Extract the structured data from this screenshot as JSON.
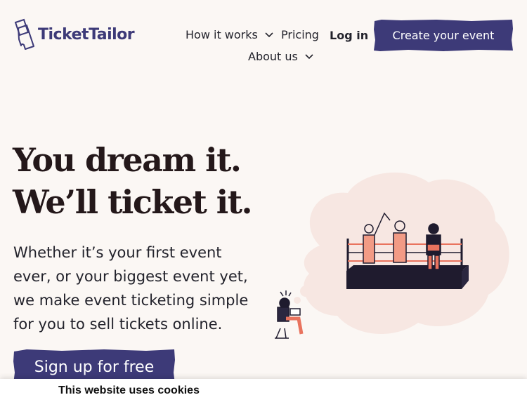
{
  "brand": {
    "name": "TicketTailor",
    "primary_color": "#3d3a78"
  },
  "nav": {
    "how_it_works": "How it works",
    "pricing": "Pricing",
    "login": "Log in",
    "about_us": "About us",
    "create_event": "Create your event"
  },
  "hero": {
    "title_line1": "You dream it.",
    "title_line2": "We’ll ticket it.",
    "subtitle": "Whether it’s your first event ever, or your biggest event yet, we make event ticketing simple for you to sell tickets online.",
    "cta": "Sign up for free"
  },
  "cookie": {
    "title": "This website uses cookies"
  },
  "icons": {
    "dropdown": "chevron-down-icon",
    "logo": "ticket-logo-icon"
  }
}
